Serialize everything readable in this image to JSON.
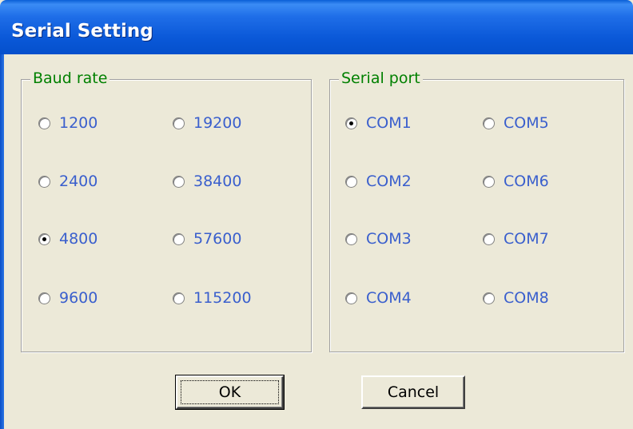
{
  "window": {
    "title": "Serial Setting"
  },
  "baud_rate_group": {
    "legend": "Baud rate",
    "options": [
      {
        "label": "1200",
        "checked": false
      },
      {
        "label": "19200",
        "checked": false
      },
      {
        "label": "2400",
        "checked": false
      },
      {
        "label": "38400",
        "checked": false
      },
      {
        "label": "4800",
        "checked": true
      },
      {
        "label": "57600",
        "checked": false
      },
      {
        "label": "9600",
        "checked": false
      },
      {
        "label": "115200",
        "checked": false
      }
    ]
  },
  "serial_port_group": {
    "legend": "Serial port",
    "options": [
      {
        "label": "COM1",
        "checked": true
      },
      {
        "label": "COM5",
        "checked": false
      },
      {
        "label": "COM2",
        "checked": false
      },
      {
        "label": "COM6",
        "checked": false
      },
      {
        "label": "COM3",
        "checked": false
      },
      {
        "label": "COM7",
        "checked": false
      },
      {
        "label": "COM4",
        "checked": false
      },
      {
        "label": "COM8",
        "checked": false
      }
    ]
  },
  "buttons": {
    "ok_label": "OK",
    "cancel_label": "Cancel"
  },
  "colors": {
    "title_bar": "#0a58d8",
    "legend_text": "#008000",
    "option_text": "#3a5fcd",
    "dialog_background": "#ece9d8"
  }
}
